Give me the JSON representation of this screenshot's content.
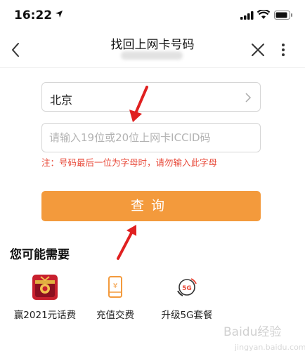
{
  "status_bar": {
    "time": "16:22"
  },
  "nav": {
    "title": "找回上网卡号码",
    "subtitle": "（已模糊）"
  },
  "form": {
    "province": "北京",
    "iccid_placeholder": "请输入19位或20位上网卡ICCID码",
    "note": "注：号码最后一位为字母时，请勿输入此字母",
    "query_label": "查询"
  },
  "recommend": {
    "title": "您可能需要",
    "items": [
      {
        "label": "赢2021元话费",
        "icon": "gift-box-icon"
      },
      {
        "label": "充值交费",
        "icon": "recharge-phone-icon"
      },
      {
        "label": "升级5G套餐",
        "icon": "5g-icon"
      }
    ]
  },
  "colors": {
    "accent": "#f39a3c",
    "note": "#e84a3a",
    "annotation": "#e02020"
  },
  "watermark": {
    "text": "Baidu经验",
    "sub": "jingyan.baidu.com"
  }
}
